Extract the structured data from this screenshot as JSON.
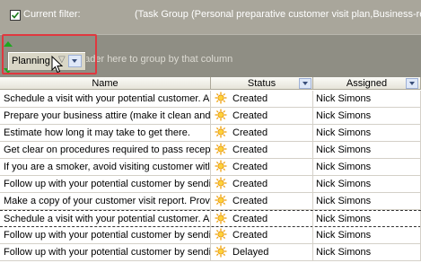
{
  "filter": {
    "checked": true,
    "label": "Current filter:",
    "expression": "(Task Group  (Personal preparative customer visit plan,Business-re"
  },
  "group_panel": {
    "hint": "eader here to group by that column",
    "dragged_column": "Planning",
    "sort_glyph": "▽"
  },
  "columns": {
    "name": "Name",
    "status": "Status",
    "assigned": "Assigned"
  },
  "rows": [
    {
      "name": "Schedule a visit with your potential customer. A",
      "status": "Created",
      "assigned": "Nick Simons"
    },
    {
      "name": "Prepare your business attire (make it clean and",
      "status": "Created",
      "assigned": "Nick Simons"
    },
    {
      "name": "Estimate how long it may take to get there.",
      "status": "Created",
      "assigned": "Nick Simons"
    },
    {
      "name": "Get clear on procedures required to pass recept",
      "status": "Created",
      "assigned": "Nick Simons"
    },
    {
      "name": "If you are a smoker, avoid visiting customer witl",
      "status": "Created",
      "assigned": "Nick Simons"
    },
    {
      "name": "Follow up with your potential customer by sendi",
      "status": "Created",
      "assigned": "Nick Simons"
    },
    {
      "name": "Make a copy of your customer visit report. Prov",
      "status": "Created",
      "assigned": "Nick Simons"
    },
    {
      "name": "Schedule a visit with your potential customer. A",
      "status": "Created",
      "assigned": "Nick Simons"
    },
    {
      "name": "Follow up with your potential customer by sendi",
      "status": "Created",
      "assigned": "Nick Simons"
    },
    {
      "name": "Follow up with your potential customer by sendi",
      "status": "Delayed",
      "assigned": "Nick Simons"
    }
  ],
  "colors": {
    "filter_bar": "#a9a69b",
    "group_panel": "#8f8e84",
    "highlight": "#e0383f",
    "move_arrows": "#1ea81e"
  },
  "icons": {
    "status": "sun-icon",
    "cursor": "mouse-pointer-icon"
  }
}
